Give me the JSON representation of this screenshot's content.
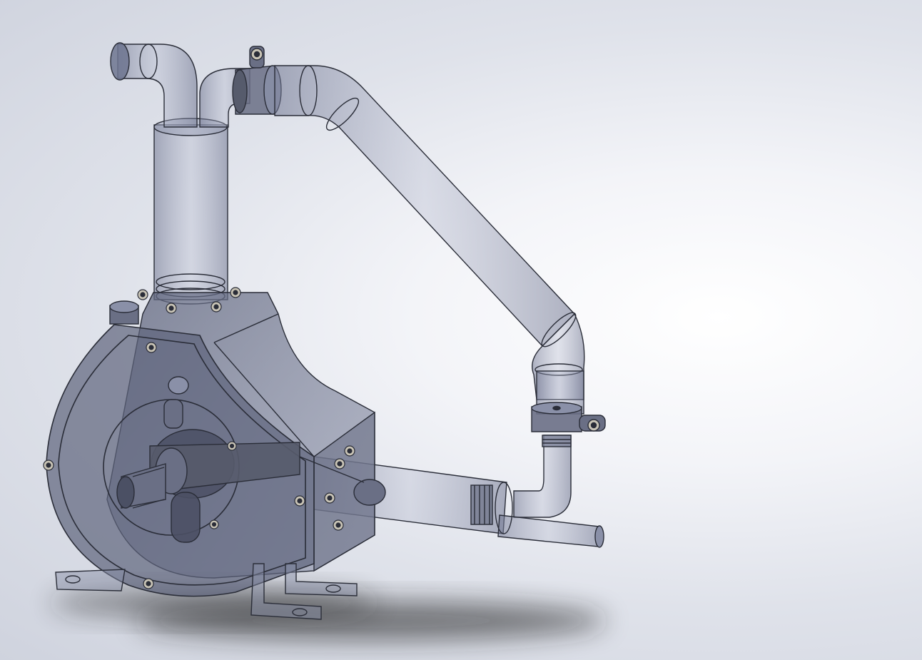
{
  "scene": {
    "subject": "transparent-pump-assembly",
    "render_style": "transparent-shaded-with-edges",
    "colors": {
      "background_center": "#ffffff",
      "background_edge": "#cfd3de",
      "part_fill": "#8a90a8",
      "part_edge": "#2a2d38",
      "solid_dark": "#565b6c",
      "bolt_fill": "#c9c4b6",
      "shadow": "#1c1c1c"
    }
  }
}
